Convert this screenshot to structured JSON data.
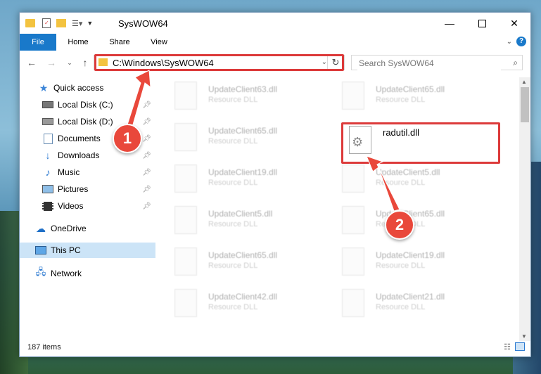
{
  "window": {
    "title": "SysWOW64"
  },
  "ribbon": {
    "tabs": [
      {
        "label": "File"
      },
      {
        "label": "Home"
      },
      {
        "label": "Share"
      },
      {
        "label": "View"
      }
    ],
    "help": "?"
  },
  "address": {
    "path": "C:\\Windows\\SysWOW64",
    "search_placeholder": "Search SysWOW64"
  },
  "nav": {
    "items": [
      {
        "label": "Quick access"
      },
      {
        "label": "Local Disk (C:)"
      },
      {
        "label": "Local Disk (D:)"
      },
      {
        "label": "Documents"
      },
      {
        "label": "Downloads"
      },
      {
        "label": "Music"
      },
      {
        "label": "Pictures"
      },
      {
        "label": "Videos"
      },
      {
        "label": "OneDrive"
      },
      {
        "label": "This PC"
      },
      {
        "label": "Network"
      }
    ]
  },
  "files": {
    "left": [
      {
        "name": "UpdateClient63.dll",
        "desc": "Resource DLL"
      },
      {
        "name": "UpdateClient65.dll",
        "desc": "Resource DLL"
      },
      {
        "name": "UpdateClient19.dll",
        "desc": "Resource DLL"
      },
      {
        "name": "UpdateClient5.dll",
        "desc": "Resource DLL"
      },
      {
        "name": "UpdateClient65.dll",
        "desc": "Resource DLL"
      },
      {
        "name": "UpdateClient42.dll",
        "desc": "Resource DLL"
      }
    ],
    "right": [
      {
        "name": "UpdateClient65.dll",
        "desc": "Resource DLL"
      },
      {
        "name": "radutil.dll",
        "desc": ""
      },
      {
        "name": "UpdateClient5.dll",
        "desc": "Resource DLL"
      },
      {
        "name": "UpdateClient65.dll",
        "desc": "Resource DLL"
      },
      {
        "name": "UpdateClient19.dll",
        "desc": "Resource DLL"
      },
      {
        "name": "UpdateClient21.dll",
        "desc": "Resource DLL"
      }
    ]
  },
  "status": {
    "count": "187 items"
  },
  "annotations": {
    "step1": "1",
    "step2": "2",
    "color": "#dc3a3a"
  }
}
